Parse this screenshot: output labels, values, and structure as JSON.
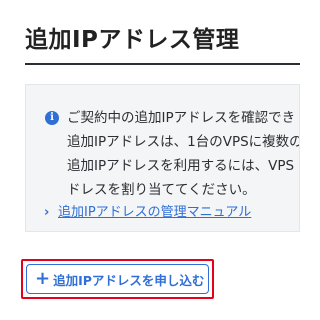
{
  "page": {
    "title": "追加IPアドレス管理"
  },
  "info": {
    "icon": "info-icon",
    "icon_glyph": "i",
    "lines": [
      "ご契約中の追加IPアドレスを確認でき",
      "追加IPアドレスは、1台のVPSに複数の",
      "追加IPアドレスを利用するには、VPS",
      "ドレスを割り当ててください。"
    ],
    "manual_link": {
      "icon": "chevron-right-icon",
      "icon_glyph": "›",
      "label": "追加IPアドレスの管理マニュアル"
    }
  },
  "actions": {
    "apply_button": {
      "icon": "plus-icon",
      "icon_glyph": "+",
      "label": "追加IPアドレスを申し込む"
    }
  },
  "colors": {
    "accent": "#2f6fd6",
    "highlight": "#e5001b",
    "panel_bg": "#f3f5f7"
  }
}
